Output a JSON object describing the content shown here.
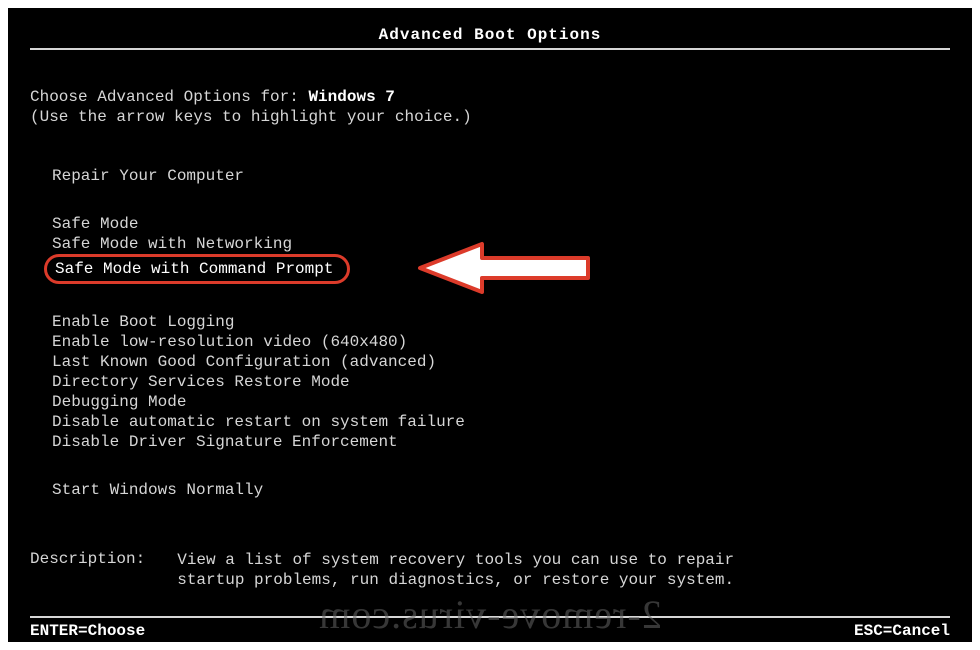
{
  "title": "Advanced Boot Options",
  "choose_prefix": "Choose Advanced Options for: ",
  "os_name": "Windows 7",
  "arrow_hint": "(Use the arrow keys to highlight your choice.)",
  "groups": [
    {
      "items": [
        "Repair Your Computer"
      ]
    },
    {
      "items": [
        "Safe Mode",
        "Safe Mode with Networking",
        "Safe Mode with Command Prompt"
      ],
      "highlighted_index": 2
    },
    {
      "items": [
        "Enable Boot Logging",
        "Enable low-resolution video (640x480)",
        "Last Known Good Configuration (advanced)",
        "Directory Services Restore Mode",
        "Debugging Mode",
        "Disable automatic restart on system failure",
        "Disable Driver Signature Enforcement"
      ]
    },
    {
      "items": [
        "Start Windows Normally"
      ]
    }
  ],
  "description_label": "Description:",
  "description_text": "View a list of system recovery tools you can use to repair startup problems, run diagnostics, or restore your system.",
  "footer_left": "ENTER=Choose",
  "footer_right": "ESC=Cancel",
  "watermark": "2-remove-virus.com",
  "annotation_color": "#dc3b2a"
}
